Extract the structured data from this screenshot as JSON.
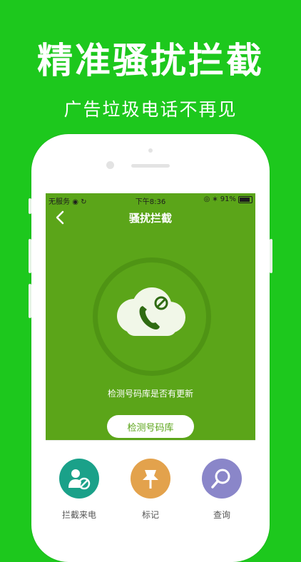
{
  "promo": {
    "headline": "精准骚扰拦截",
    "subheadline": "广告垃圾电话不再见"
  },
  "statusbar": {
    "carrier": "无服务",
    "time": "下午8:36",
    "battery": "91%"
  },
  "screen": {
    "title": "骚扰拦截",
    "status_text": "检测号码库是否有更新",
    "detect_button": "检测号码库"
  },
  "tools": [
    {
      "label": "拦截来电",
      "icon": "contact-block-icon",
      "color": "#1aa189"
    },
    {
      "label": "标记",
      "icon": "pin-icon",
      "color": "#e3a24c"
    },
    {
      "label": "查询",
      "icon": "search-icon",
      "color": "#8a86c9"
    }
  ],
  "colors": {
    "background": "#1dc81d",
    "screen_green": "#5ba519"
  }
}
